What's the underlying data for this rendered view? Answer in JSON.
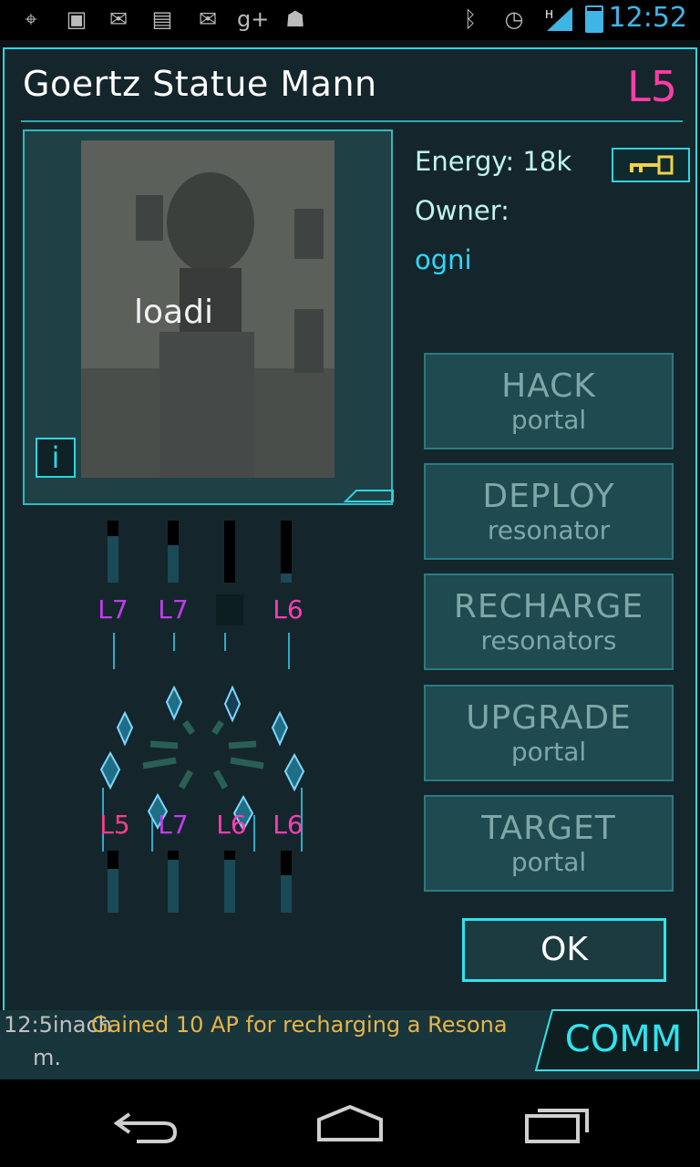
{
  "status_bar": {
    "time": "12:52",
    "icons": [
      "gps-icon",
      "gallery-icon",
      "gmail-icon",
      "talk-icon",
      "gmail-icon",
      "google-plus-icon",
      "android-icon",
      "bluetooth-icon",
      "alarm-icon",
      "signal-icon",
      "battery-icon"
    ],
    "signal_label": "H",
    "battery_level": 0.85
  },
  "portal": {
    "title": "Goertz Statue Mann",
    "level": "L5",
    "image_overlay_text": "loadi",
    "info_label": "i",
    "energy_label": "Energy:",
    "energy_value": "18k",
    "owner_label": "Owner:",
    "owner_name": "ogni"
  },
  "actions": [
    {
      "main": "HACK",
      "sub": "portal"
    },
    {
      "main": "DEPLOY",
      "sub": "resonator"
    },
    {
      "main": "RECHARGE",
      "sub": "resonators"
    },
    {
      "main": "UPGRADE",
      "sub": "portal"
    },
    {
      "main": "TARGET",
      "sub": "portal"
    }
  ],
  "ok_label": "OK",
  "resonators": {
    "top": [
      {
        "label": "L7",
        "fill": 0.75,
        "color": "#c23cf0"
      },
      {
        "label": "L7",
        "fill": 0.6,
        "color": "#c23cf0"
      },
      {
        "label": "",
        "fill": 0.0,
        "color": "#000000"
      },
      {
        "label": "L6",
        "fill": 0.15,
        "color": "#ff3cb8"
      }
    ],
    "bottom": [
      {
        "label": "L5",
        "fill": 0.7,
        "color": "#ff3c8c"
      },
      {
        "label": "L7",
        "fill": 0.85,
        "color": "#c23cf0"
      },
      {
        "label": "L6",
        "fill": 0.85,
        "color": "#ff3cb8"
      },
      {
        "label": "L6",
        "fill": 0.6,
        "color": "#ff3cb8"
      }
    ]
  },
  "comm": {
    "line1_prefix": "12:5inach",
    "line1_message": "Gained 10 AP for recharging a Resona",
    "line2": "m.",
    "button_label": "COMM"
  },
  "colors": {
    "accent": "#2fd4e0",
    "level_magenta": "#ff3ca6",
    "owner_cyan": "#2fd7ff"
  }
}
